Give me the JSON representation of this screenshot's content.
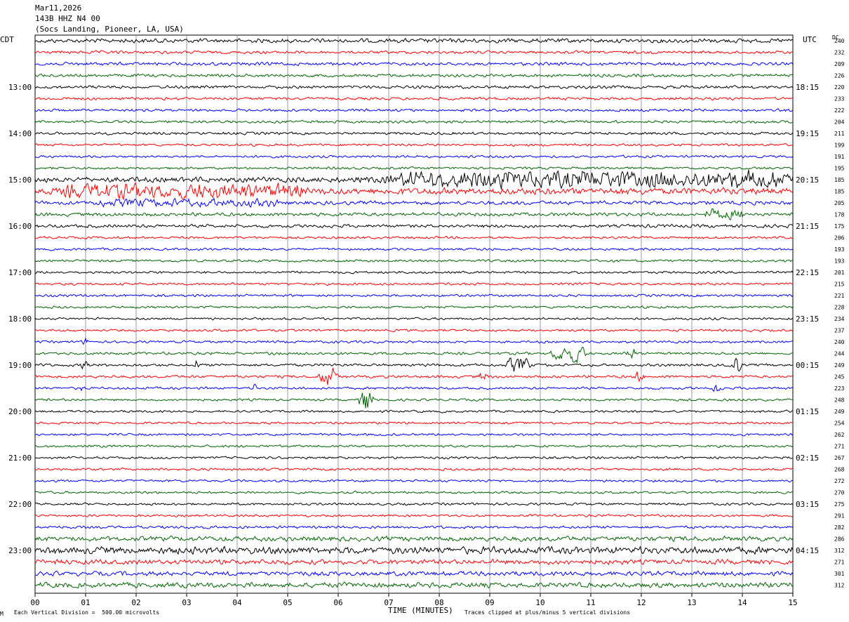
{
  "header": {
    "date": "Mar11,2026",
    "channel": "143B HHZ N4 00",
    "location": "(Socs Landing, Pioneer, LA, USA)"
  },
  "left_tz": "CDT",
  "right_tz": "UTC",
  "dc_label": "DC",
  "footer": {
    "scale_note": "Each Vertical Division =  500.00 microvolts",
    "xlabel": "TIME (MINUTES)",
    "clip_note": "Traces clipped at plus/minus 5 vertical divisions",
    "corner_mark": "M"
  },
  "colors": {
    "trace_cycle": [
      "#000000",
      "#ff0000",
      "#0000ff",
      "#006600"
    ],
    "grid": "#8080a0"
  },
  "chart_data": {
    "type": "line",
    "description_type": "helicorder seismogram",
    "xlabel": "TIME (MINUTES)",
    "x_ticks": [
      "00",
      "01",
      "02",
      "03",
      "04",
      "05",
      "06",
      "07",
      "08",
      "09",
      "10",
      "11",
      "12",
      "13",
      "14",
      "15"
    ],
    "xlim": [
      0,
      15
    ],
    "minutes_per_row": 15,
    "row_count": 48,
    "cdt_hour_labels": [
      "13:00",
      "14:00",
      "15:00",
      "16:00",
      "17:00",
      "18:00",
      "19:00",
      "20:00",
      "21:00",
      "22:00",
      "23:00"
    ],
    "utc_hour_labels": [
      "18:15",
      "19:15",
      "20:15",
      "21:15",
      "22:15",
      "23:15",
      "00:15",
      "01:15",
      "02:15",
      "03:15",
      "04:15"
    ],
    "dc_offsets": [
      240,
      232,
      209,
      226,
      220,
      233,
      222,
      204,
      211,
      199,
      191,
      195,
      185,
      185,
      205,
      178,
      175,
      206,
      193,
      193,
      201,
      215,
      221,
      228,
      234,
      237,
      240,
      244,
      249,
      245,
      223,
      248,
      249,
      254,
      262,
      271,
      267,
      268,
      272,
      270,
      275,
      291,
      282,
      286,
      312,
      271,
      301,
      312
    ],
    "row_noise_level": [
      1.4,
      1.0,
      1.1,
      1.0,
      1.0,
      0.9,
      0.9,
      0.9,
      0.9,
      0.8,
      0.8,
      0.8,
      1.8,
      2.2,
      1.3,
      1.2,
      1.1,
      0.8,
      0.8,
      0.8,
      0.8,
      0.8,
      0.8,
      0.8,
      0.8,
      0.8,
      0.8,
      0.9,
      0.9,
      0.9,
      0.8,
      0.8,
      0.8,
      0.8,
      0.8,
      0.8,
      0.8,
      0.8,
      0.8,
      0.8,
      0.8,
      0.8,
      0.9,
      1.6,
      2.4,
      1.6,
      1.5,
      1.7
    ],
    "events": [
      {
        "row": 12,
        "start_min": 6.3,
        "end_min": 15.0,
        "amp": 3.0
      },
      {
        "row": 13,
        "start_min": 0.0,
        "end_min": 5.3,
        "amp": 2.6
      },
      {
        "row": 14,
        "start_min": 0.8,
        "end_min": 4.8,
        "amp": 1.4
      },
      {
        "row": 15,
        "start_min": 13.2,
        "end_min": 14.0,
        "amp": 1.8
      },
      {
        "row": 26,
        "start_min": 0.9,
        "end_min": 1.1,
        "amp": 1.4
      },
      {
        "row": 27,
        "start_min": 10.2,
        "end_min": 10.9,
        "amp": 3.2
      },
      {
        "row": 27,
        "start_min": 11.7,
        "end_min": 11.9,
        "amp": 2.8
      },
      {
        "row": 28,
        "start_min": 0.9,
        "end_min": 1.1,
        "amp": 2.4
      },
      {
        "row": 28,
        "start_min": 3.1,
        "end_min": 3.3,
        "amp": 2.2
      },
      {
        "row": 28,
        "start_min": 9.3,
        "end_min": 9.8,
        "amp": 2.6
      },
      {
        "row": 28,
        "start_min": 13.7,
        "end_min": 14.0,
        "amp": 3.4
      },
      {
        "row": 29,
        "start_min": 5.6,
        "end_min": 6.0,
        "amp": 4.2
      },
      {
        "row": 29,
        "start_min": 8.7,
        "end_min": 9.0,
        "amp": 1.6
      },
      {
        "row": 29,
        "start_min": 11.8,
        "end_min": 12.1,
        "amp": 1.8
      },
      {
        "row": 30,
        "start_min": 0.9,
        "end_min": 1.0,
        "amp": 2.0
      },
      {
        "row": 30,
        "start_min": 4.3,
        "end_min": 4.4,
        "amp": 2.0
      },
      {
        "row": 30,
        "start_min": 13.4,
        "end_min": 13.6,
        "amp": 2.4
      },
      {
        "row": 31,
        "start_min": 6.4,
        "end_min": 6.7,
        "amp": 5.0
      }
    ]
  }
}
